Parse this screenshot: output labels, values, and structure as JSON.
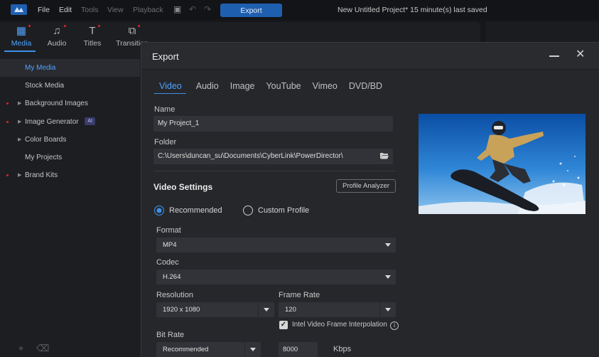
{
  "menubar": {
    "file": "File",
    "edit": "Edit",
    "tools": "Tools",
    "view": "View",
    "playback": "Playback",
    "export_button": "Export",
    "project_title": "New Untitled Project* 15 minute(s) last saved"
  },
  "library_tabs": [
    {
      "label": "Media",
      "icon": "media-icon"
    },
    {
      "label": "Audio",
      "icon": "music-note-icon"
    },
    {
      "label": "Titles",
      "icon": "titles-icon"
    },
    {
      "label": "Transition",
      "icon": "transition-icon"
    }
  ],
  "sidebar": {
    "items": [
      {
        "label": "My Media"
      },
      {
        "label": "Stock Media"
      },
      {
        "label": "Background Images"
      },
      {
        "label": "Image Generator",
        "badge": "AI"
      },
      {
        "label": "Color Boards"
      },
      {
        "label": "My Projects"
      },
      {
        "label": "Brand Kits"
      }
    ]
  },
  "dialog": {
    "title": "Export",
    "tabs": [
      "Video",
      "Audio",
      "Image",
      "YouTube",
      "Vimeo",
      "DVD/BD"
    ],
    "name_label": "Name",
    "name_value": "My Project_1",
    "folder_label": "Folder",
    "folder_value": "C:\\Users\\duncan_su\\Documents\\CyberLink\\PowerDirector\\",
    "video_settings_title": "Video Settings",
    "profile_analyzer": "Profile Analyzer",
    "radio_recommended": "Recommended",
    "radio_custom": "Custom Profile",
    "format_label": "Format",
    "format_value": "MP4",
    "codec_label": "Codec",
    "codec_value": "H.264",
    "resolution_label": "Resolution",
    "resolution_value": "1920 x 1080",
    "framerate_label": "Frame Rate",
    "framerate_value": "120",
    "interpolation_label": "Intel Video Frame Interpolation",
    "bitrate_label": "Bit Rate",
    "bitrate_mode": "Recommended",
    "bitrate_value": "8000",
    "bitrate_unit": "Kbps"
  },
  "colors": {
    "accent": "#3d8fe8",
    "export_button": "#1f5fb0",
    "dialog_bg": "#26272b"
  }
}
